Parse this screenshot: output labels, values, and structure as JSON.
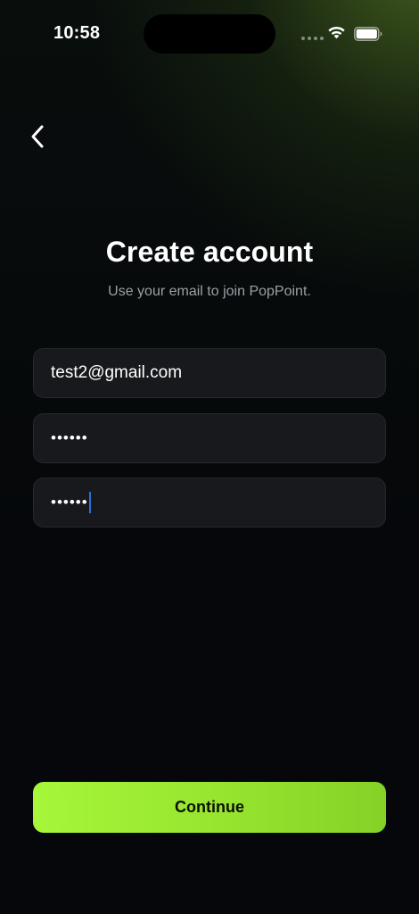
{
  "status_bar": {
    "time": "10:58"
  },
  "header": {
    "back_icon": "chevron-left-icon",
    "title": "Create account",
    "subtitle": "Use your email to join PopPoint."
  },
  "form": {
    "email_value": "test2@gmail.com",
    "password_value": "••••••",
    "confirm_password_value": "••••••"
  },
  "footer": {
    "continue_label": "Continue"
  },
  "colors": {
    "accent": "#a6f63a",
    "background": "#05070a",
    "field": "#17191d",
    "subtitle": "#9aa0a6"
  }
}
